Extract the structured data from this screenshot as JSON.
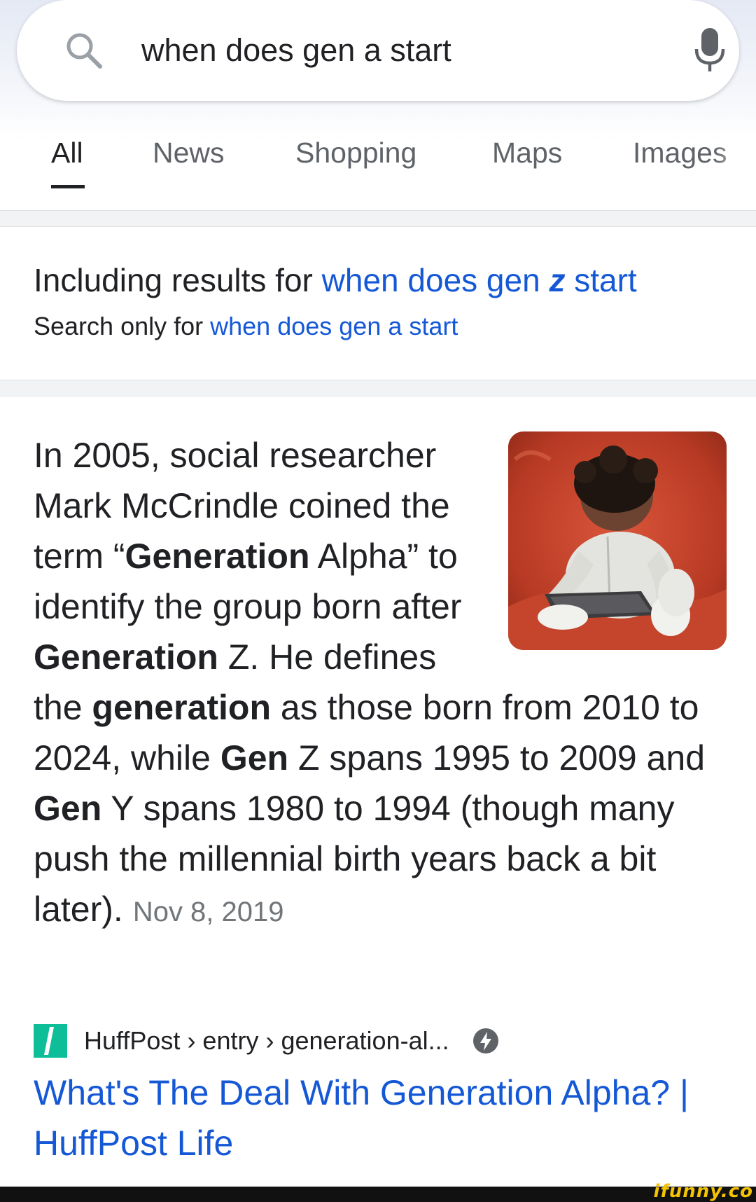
{
  "search": {
    "query": "when does gen a start"
  },
  "tabs": [
    {
      "label": "All",
      "active": true
    },
    {
      "label": "News",
      "active": false
    },
    {
      "label": "Shopping",
      "active": false
    },
    {
      "label": "Maps",
      "active": false
    },
    {
      "label": "Images",
      "active": false
    }
  ],
  "spelling": {
    "including_prefix": "Including results for",
    "corrected_before": "when does gen",
    "corrected_bold": "z",
    "corrected_after": "start",
    "search_only_prefix": "Search only for",
    "original_query": "when does gen a start"
  },
  "snippet": {
    "parts": [
      {
        "text": "In 2005, social researcher Mark McCrindle coined the term “",
        "bold": false
      },
      {
        "text": "Generation",
        "bold": true
      },
      {
        "text": " Alpha” to identify the group born after ",
        "bold": false
      },
      {
        "text": "Generation",
        "bold": true
      },
      {
        "text": " Z. He defines the ",
        "bold": false
      },
      {
        "text": "generation",
        "bold": true
      },
      {
        "text": " as those born from 2010 to 2024, while ",
        "bold": false
      },
      {
        "text": "Gen",
        "bold": true
      },
      {
        "text": " Z spans 1995 to 2009 and ",
        "bold": false
      },
      {
        "text": "Gen",
        "bold": true
      },
      {
        "text": " Y spans 1980 to 1994 (though many push the millennial birth years back a bit later).",
        "bold": false
      }
    ],
    "date": "Nov 8, 2019",
    "image_icon": "baby-with-tablet-photo"
  },
  "source": {
    "site": "HuffPost",
    "path": "› entry › generation-al...",
    "favicon": "huffpost-favicon",
    "amp_icon": "amp-lightning-icon",
    "title": "What's The Deal With Generation Alpha? | HuffPost Life"
  },
  "watermark": "ifunny.co",
  "colors": {
    "link": "#1558d6",
    "text": "#202124",
    "muted": "#5f6368",
    "huffpost_green": "#0dbe98"
  }
}
